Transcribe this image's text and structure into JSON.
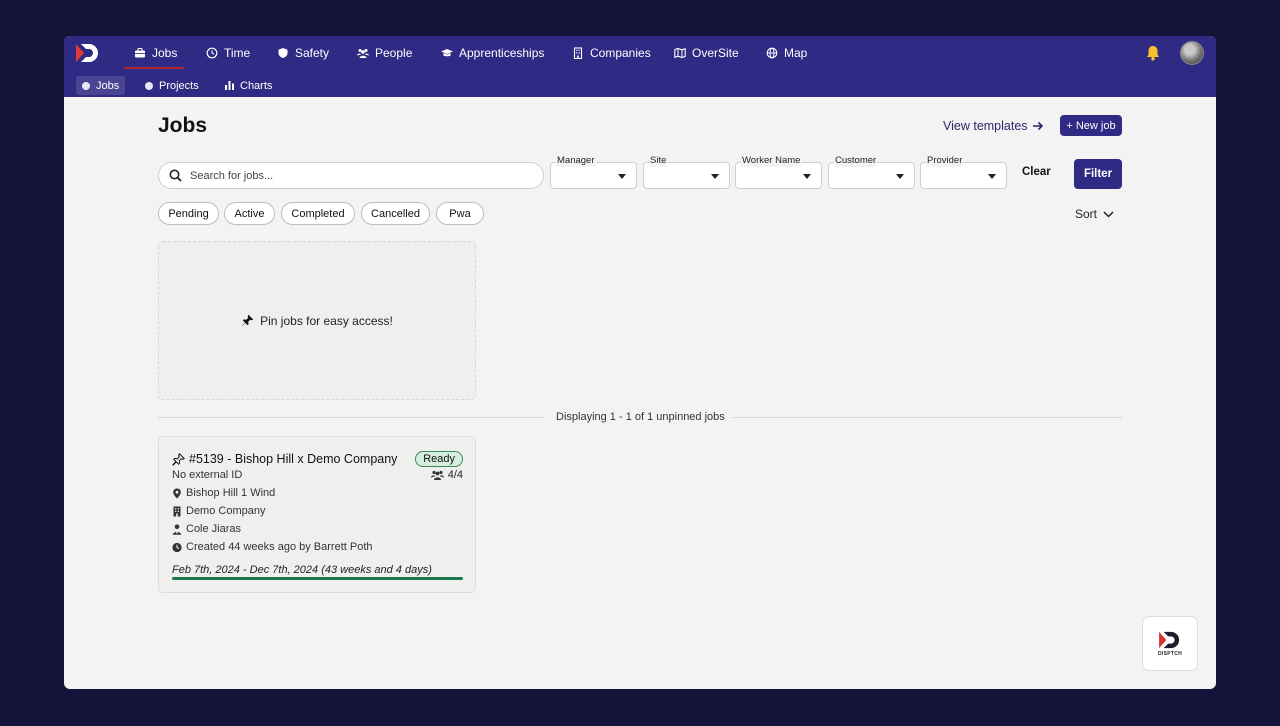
{
  "topnav": {
    "items": [
      {
        "label": "Jobs",
        "icon": "briefcase-icon"
      },
      {
        "label": "Time",
        "icon": "clock-icon"
      },
      {
        "label": "Safety",
        "icon": "shield-icon"
      },
      {
        "label": "People",
        "icon": "users-icon"
      },
      {
        "label": "Apprenticeships",
        "icon": "graduation-cap-icon"
      },
      {
        "label": "Companies",
        "icon": "building-icon"
      },
      {
        "label": "OverSite",
        "icon": "map-fold-icon"
      },
      {
        "label": "Map",
        "icon": "globe-icon"
      }
    ],
    "active": "Jobs"
  },
  "subnav": {
    "items": [
      {
        "label": "Jobs"
      },
      {
        "label": "Projects"
      },
      {
        "label": "Charts"
      }
    ],
    "active": "Jobs"
  },
  "page": {
    "title": "Jobs",
    "view_templates": "View templates",
    "new_job": "+ New job"
  },
  "filters": {
    "search_placeholder": "Search for jobs...",
    "selects": [
      {
        "label": "Manager",
        "value": ""
      },
      {
        "label": "Site",
        "value": ""
      },
      {
        "label": "Worker Name",
        "value": ""
      },
      {
        "label": "Customer",
        "value": ""
      },
      {
        "label": "Provider",
        "value": ""
      }
    ],
    "clear": "Clear",
    "filter": "Filter"
  },
  "chips": [
    "Pending",
    "Active",
    "Completed",
    "Cancelled",
    "Pwa"
  ],
  "sort": "Sort",
  "pinned": {
    "empty_text": "Pin jobs for easy access!"
  },
  "displaying": "Displaying 1 - 1 of 1 unpinned jobs",
  "jobs": [
    {
      "title": "#5139 - Bishop Hill x Demo Company",
      "status": "Ready",
      "external_id": "No external ID",
      "workers": "4/4",
      "site": "Bishop Hill 1 Wind",
      "company": "Demo Company",
      "manager": "Cole Jiaras",
      "created": "Created 44 weeks ago by Barrett Poth",
      "dates": "Feb 7th, 2024 - Dec 7th, 2024 (43 weeks and 4 days)",
      "progress": 1.0
    }
  ],
  "colors": {
    "nav_bg": "#2f2a83",
    "accent": "#2f2a83",
    "active_underline": "#b5252d",
    "ready_badge": "#d7eedf",
    "progress": "#1a7a4e"
  }
}
